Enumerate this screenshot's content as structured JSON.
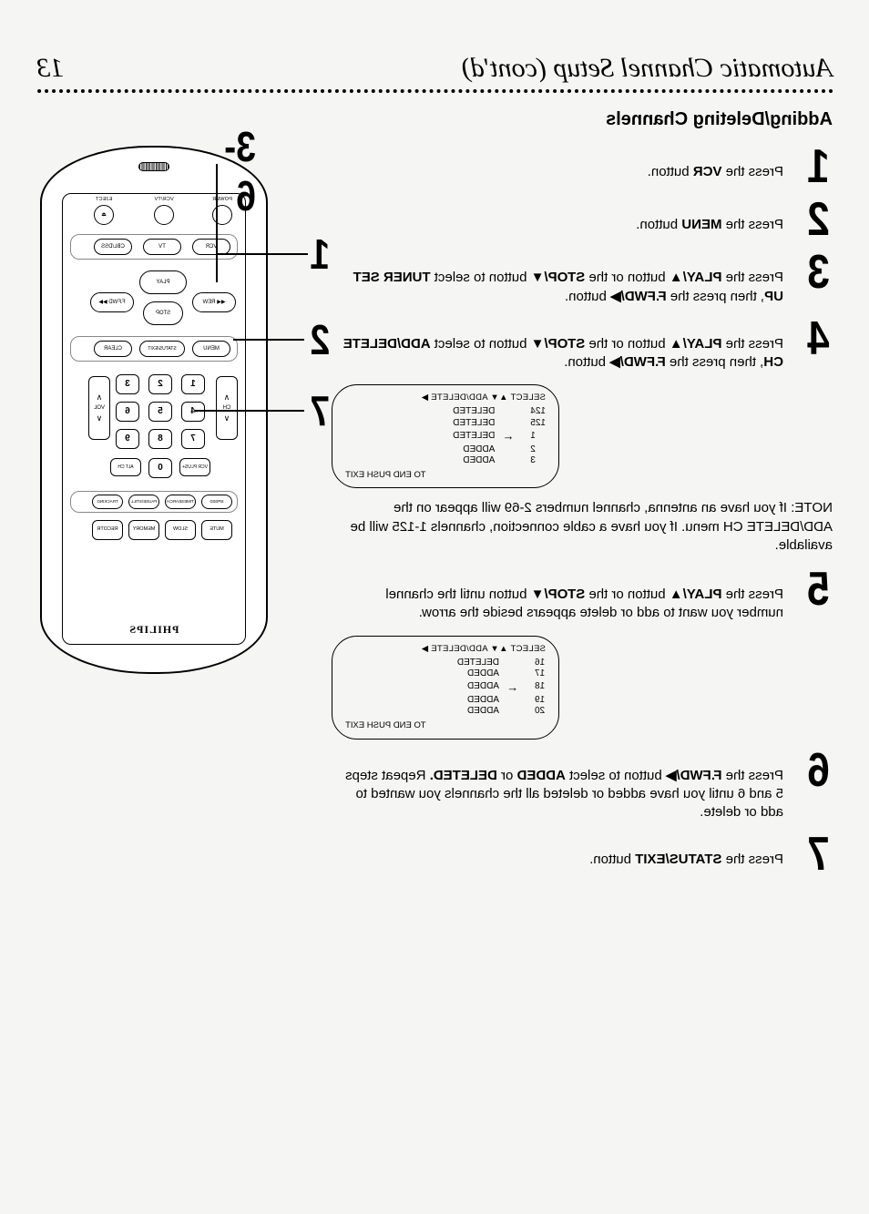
{
  "header": {
    "title": "Automatic Channel Setup (cont'd)",
    "page": "13"
  },
  "subtitle": "Adding/Deleting Channels",
  "steps": [
    {
      "n": "1",
      "body": "Press the <b>VCR</b> button."
    },
    {
      "n": "2",
      "body": "Press the <b>MENU</b> button."
    },
    {
      "n": "3",
      "body": "Press the <b>PLAY/▲</b> button or the <b>STOP/▼</b> button to select <b>TUNER SET UP</b>, then press the <b>F.FWD/▶</b> button."
    },
    {
      "n": "4",
      "body": "Press the <b>PLAY/▲</b> button or the <b>STOP/▼</b> button to select <b>ADD/DELETE CH</b>, then press the <b>F.FWD/▶</b> button."
    },
    {
      "n": "5",
      "body": "Press the <b>PLAY/▲</b> button or the <b>STOP/▼</b> button until the channel number you want to add or delete appears beside the arrow."
    },
    {
      "n": "6",
      "body": "Press the <b>F.FWD/▶</b> button to select <b>ADDED</b> or <b>DELETED.</b> Repeat steps 5 and 6 until you have added or deleted all the channels you wanted to add or delete."
    },
    {
      "n": "7",
      "body": "Press the <b>STATUS/EXIT</b> button."
    }
  ],
  "note_after_step4": "NOTE: If you have an antenna, channel numbers 2-69 will appear on the ADD/DELETE CH menu. If you have a cable connection, channels 1-125 will be available.",
  "osd1": {
    "header": "SELECT ▲▼  ADD/DELETE ▶",
    "rows": [
      {
        "ch": "124",
        "arrow": "",
        "status": "DELETED"
      },
      {
        "ch": "125",
        "arrow": "",
        "status": "DELETED"
      },
      {
        "ch": "1",
        "arrow": "←",
        "status": "DELETED"
      },
      {
        "ch": "2",
        "arrow": "",
        "status": "ADDED"
      },
      {
        "ch": "3",
        "arrow": "",
        "status": "ADDED"
      }
    ],
    "footer": "TO END PUSH EXIT"
  },
  "osd2": {
    "header": "SELECT ▲▼  ADD/DELETE ▶",
    "rows": [
      {
        "ch": "16",
        "arrow": "",
        "status": "DELETED"
      },
      {
        "ch": "17",
        "arrow": "",
        "status": "ADDED"
      },
      {
        "ch": "18",
        "arrow": "←",
        "status": "ADDED"
      },
      {
        "ch": "19",
        "arrow": "",
        "status": "ADDED"
      },
      {
        "ch": "20",
        "arrow": "",
        "status": "ADDED"
      }
    ],
    "footer": "TO END PUSH EXIT"
  },
  "callouts": {
    "top": "3-6",
    "c1": "1",
    "c2": "2",
    "c7": "7"
  },
  "remote": {
    "brand": "PHILIPS",
    "top_row": [
      {
        "label": "POWER"
      },
      {
        "label": "VCR/TV"
      },
      {
        "label": "EJECT",
        "glyph": "⏏"
      }
    ],
    "src_row": [
      {
        "label": "VCR"
      },
      {
        "label": "TV"
      },
      {
        "label": "CBL/DSS"
      }
    ],
    "transport": {
      "play": "PLAY",
      "rew": "◀◀ REW",
      "stop": "STOP",
      "ffwd": "F.FWD ▶▶"
    },
    "mid_row": [
      {
        "label": "MENU"
      },
      {
        "label": "STATUS/EXIT"
      },
      {
        "label": "CLEAR"
      }
    ],
    "numpad": [
      "1",
      "2",
      "3",
      "4",
      "5",
      "6",
      "7",
      "8",
      "9",
      "0"
    ],
    "left_rocker": {
      "label": "CH",
      "up": "∧",
      "down": "∨"
    },
    "right_rocker": {
      "label": "VOL",
      "up": "∧",
      "down": "∨"
    },
    "zero_left_label": "VCR PLUS+",
    "zero_right_label": "ALT CH",
    "small_row": [
      {
        "label": "SPEED"
      },
      {
        "label": "TIMESEARCH"
      },
      {
        "label": "PAUSE/STILL"
      },
      {
        "label": "TRACKING"
      }
    ],
    "bottom_row": [
      {
        "label": "MUTE"
      },
      {
        "label": "SLOW"
      },
      {
        "label": "MEMORY"
      },
      {
        "label": "RECOTR"
      }
    ]
  }
}
